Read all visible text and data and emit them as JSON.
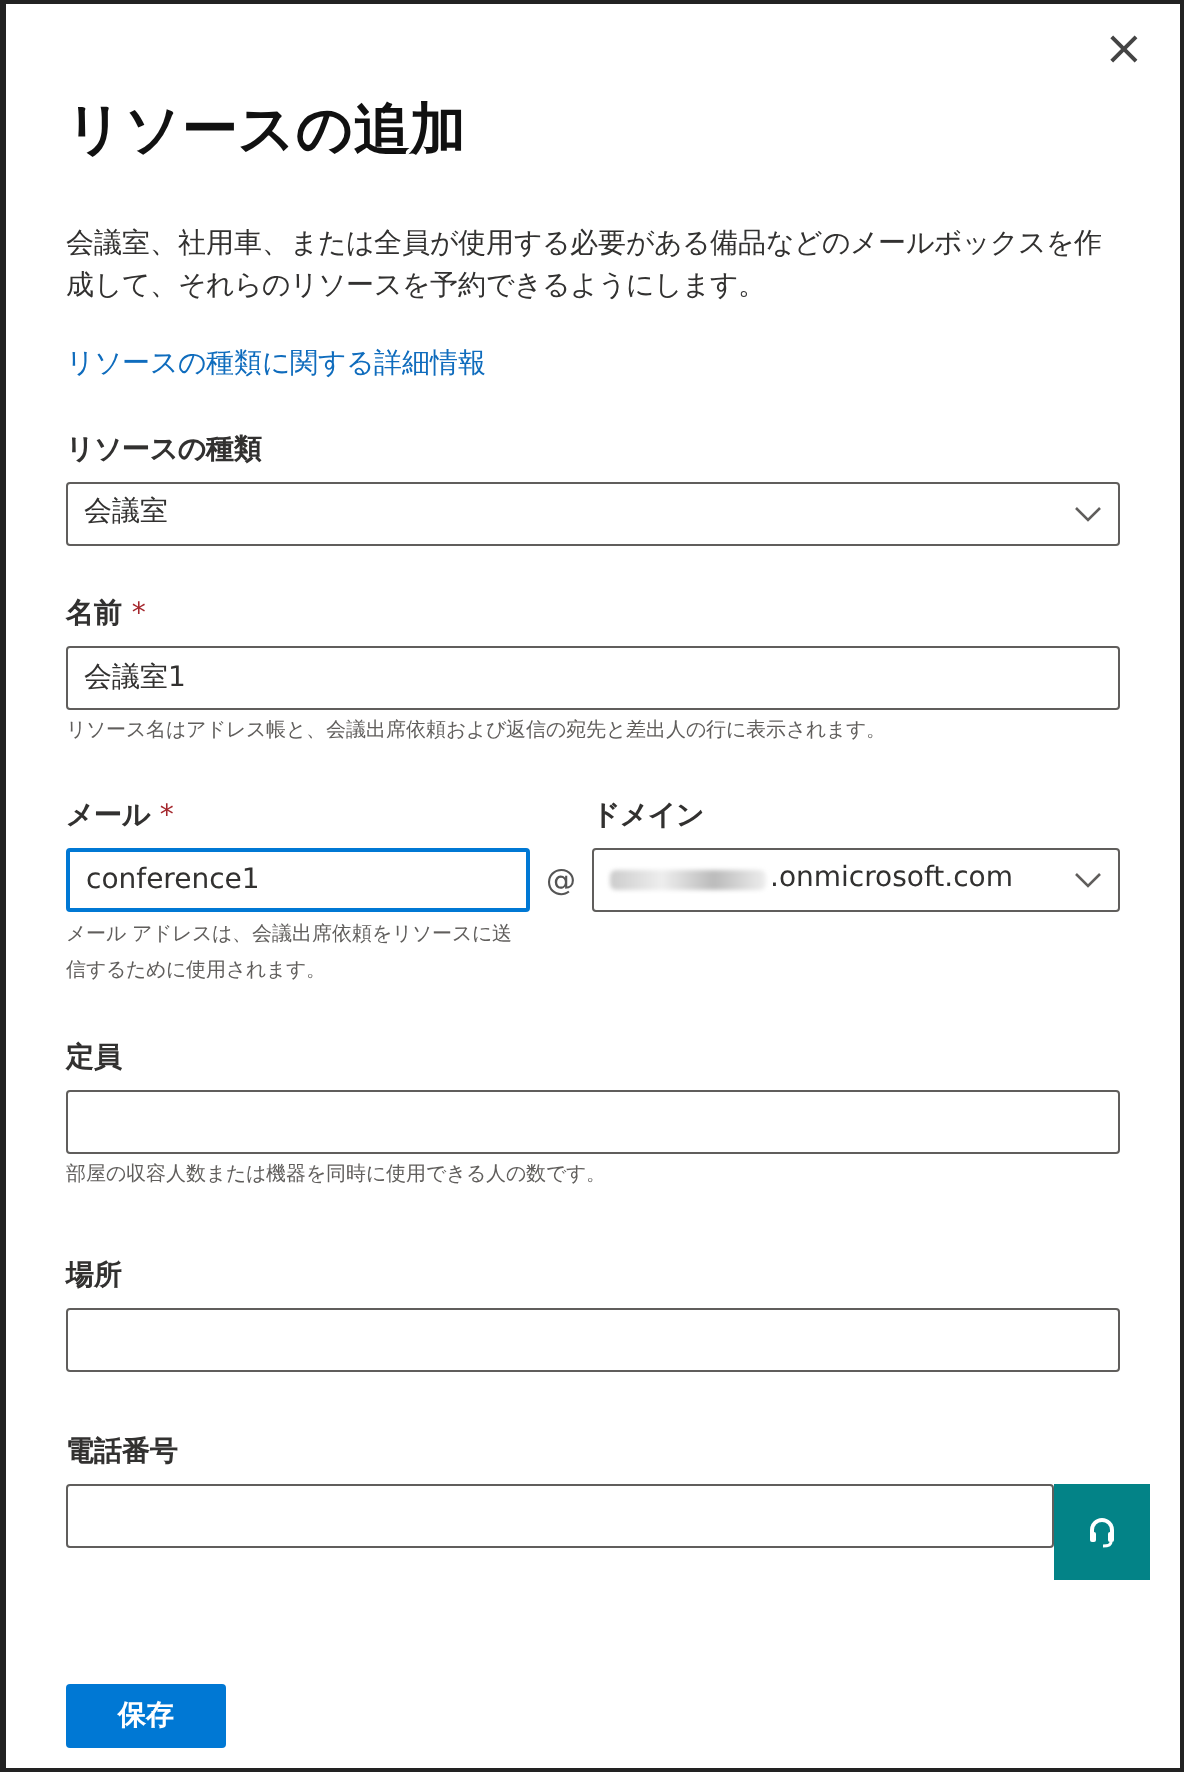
{
  "panel": {
    "title": "リソースの追加",
    "close": "×",
    "description": "会議室、社用車、または全員が使用する必要がある備品などのメールボックスを作成して、それらのリソースを予約できるようにします。",
    "link": "リソースの種類に関する詳細情報"
  },
  "fields": [
    {
      "kind": "select",
      "label": "リソースの種類",
      "value": "会議室"
    },
    {
      "kind": "text",
      "label": "名前",
      "required_mark": "*",
      "value": "会議室1",
      "hint": "リソース名はアドレス帳と、会議出席依頼および返信の宛先と差出人の行に表示されます。"
    },
    {
      "kind": "email",
      "label": "メール",
      "required_mark": "*",
      "value": "conference1",
      "focused": true,
      "hint": "メール アドレスは、会議出席依頼をリソースに送信するために使用されます。",
      "at": "@",
      "domain_label": "ドメイン",
      "domain_value": ".onmicrosoft.com"
    },
    {
      "kind": "text",
      "label": "定員",
      "hint": "部屋の収容人数または機器を同時に使用できる人の数です。"
    },
    {
      "kind": "text",
      "label": "場所"
    },
    {
      "kind": "text",
      "label": "電話番号"
    }
  ],
  "save_button": "保存"
}
